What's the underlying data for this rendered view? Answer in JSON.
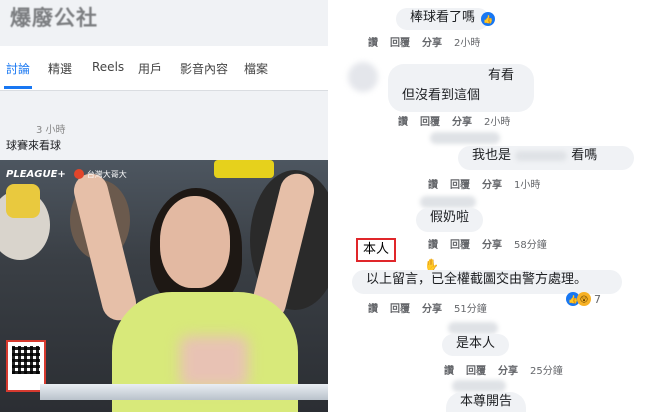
{
  "left": {
    "page_title": "爆廢公社",
    "tabs": [
      "討論",
      "精選",
      "Reels",
      "用戶",
      "影音內容",
      "檔案"
    ],
    "post_time": "3 小時",
    "post_text": "球賽來看球",
    "video": {
      "league_logo": "PLEAGUE+",
      "team_name": "台灣大哥大"
    }
  },
  "right": {
    "comments": [
      {
        "text": "棒球看了嗎",
        "actions": [
          "讚",
          "回覆",
          "分享"
        ],
        "time": "2小時",
        "reactions": "like"
      },
      {
        "text_lines": [
          "有看",
          "但沒看到這個"
        ],
        "actions": [
          "讚",
          "回覆",
          "分享"
        ],
        "time": "2小時"
      },
      {
        "text_a": "我也是",
        "text_b": "看嗎",
        "actions": [
          "讚",
          "回覆",
          "分享"
        ],
        "time": "1小時"
      },
      {
        "text": "假奶啦",
        "actions": [
          "讚",
          "回覆",
          "分享"
        ],
        "time": "58分鐘"
      },
      {
        "author": "本人",
        "text": "以上留言，已全權截圖交由警方處理。",
        "actions": [
          "讚",
          "回覆",
          "分享"
        ],
        "time": "51分鐘",
        "reaction_count": "7"
      },
      {
        "text": "是本人",
        "actions": [
          "讚",
          "回覆",
          "分享"
        ],
        "time": "25分鐘"
      },
      {
        "text": "本尊開告"
      }
    ]
  },
  "colors": {
    "accent": "#1877f2",
    "highlight_box": "#e0262a",
    "bubble": "#f0f2f5"
  }
}
